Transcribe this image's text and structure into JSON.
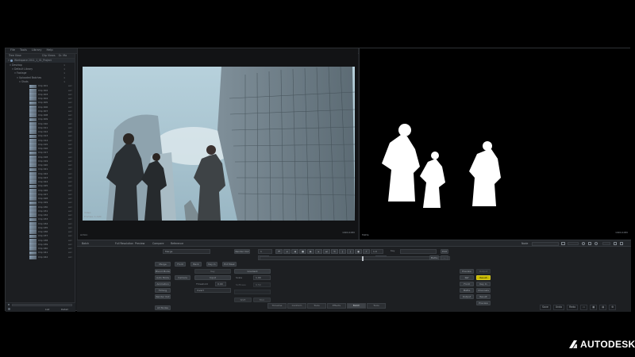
{
  "menubar": {
    "items": [
      "File",
      "Tools",
      "Library",
      "Help"
    ]
  },
  "sidebar": {
    "tabs": [
      "Tree View",
      "Clip Views",
      "Gr. Ma"
    ],
    "project": "Workspace 2011_1_01_Project",
    "tree": [
      {
        "label": "Desktop",
        "count": "1"
      },
      {
        "label": "Default Library",
        "count": "1"
      },
      {
        "label": "Footage",
        "count": "1"
      },
      {
        "label": "Uploaded Batches",
        "count": "1"
      },
      {
        "label": "Shots",
        "count": "1"
      }
    ],
    "clip_ext": "exr",
    "clips": [
      "Clip 001",
      "Clip 002",
      "Clip 003",
      "Clip 004",
      "Clip 005",
      "Clip 006",
      "Clip 007",
      "Clip 008",
      "Clip 009",
      "Clip 010",
      "Clip 011",
      "Clip 012",
      "Clip 013",
      "Clip 014",
      "Clip 015",
      "Clip 016",
      "Clip 017",
      "Clip 018",
      "Clip 019",
      "Clip 020",
      "Clip 021",
      "Clip 022",
      "Clip 023",
      "Clip 024",
      "Clip 025",
      "Clip 026",
      "Clip 027",
      "Clip 028",
      "Clip 029",
      "Clip 030",
      "Clip 031",
      "Clip 032",
      "Clip 033",
      "Clip 034",
      "Clip 035",
      "Clip 036",
      "Clip 037",
      "Clip 038",
      "Clip 039",
      "Clip 040",
      "Clip 041",
      "Clip 042"
    ],
    "footer_left": "List",
    "footer_right": "Detail"
  },
  "player_left": {
    "label": "Video",
    "info": "Frames: 1-120",
    "footer_left": "Action",
    "footer_right": "1920x1080"
  },
  "player_right": {
    "label": "Video",
    "info": "Frames: 1-120",
    "footer_left": "Matte",
    "footer_right": "1920x1080"
  },
  "toolbar": {
    "left": "Batch",
    "tabs": [
      "Full Resolution",
      "Preview",
      "Compare",
      "Reference"
    ],
    "right_label": "Node"
  },
  "controls": {
    "col_a": [
      "Merge",
      "Front",
      "Back",
      "Key In",
      "Ext Mask",
      "Blend Mode",
      "Over",
      "Add",
      "Screen",
      "Multiply"
    ],
    "col_b": [
      "Auto Mode",
      "Blend Mode",
      "Animation",
      "Timing",
      "Render Out"
    ],
    "dropdown_a": "Camera",
    "fields": [
      "Input",
      "Key",
      "Gradient",
      "Threshold",
      "Scale",
      "Softness",
      "Invert"
    ],
    "values": [
      "0.00",
      "1.00",
      "0.50"
    ],
    "right_btns": [
      "Preview",
      "Result",
      "Output",
      "Ref",
      "Front",
      "Matte",
      "Key In",
      "Channels"
    ],
    "yellow_btn": "Result",
    "left_stack": [
      "Shift",
      "Trim",
      "All Nodes"
    ]
  },
  "timeline": {
    "frame": "1",
    "start": "1",
    "end": "120",
    "speed": "1.0"
  },
  "bottom_tabs": [
    "Timeline",
    "Conform",
    "Tools",
    "Effects",
    "Batch",
    "Tools"
  ],
  "statusbar": [
    "Save",
    "Undo",
    "Redo"
  ],
  "branding": {
    "name": "AUTODESK."
  },
  "colors": {
    "accent_yellow": "#c7b800",
    "panel": "#1d1f22",
    "background": "#000000"
  }
}
